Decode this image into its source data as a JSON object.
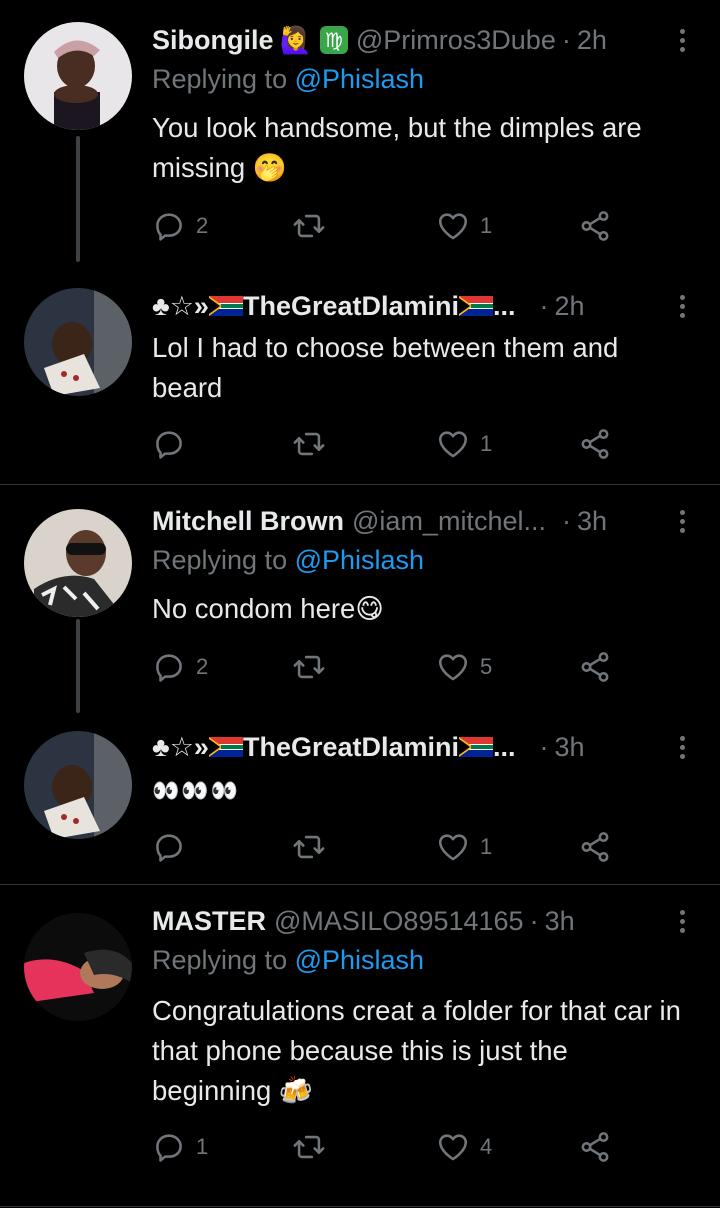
{
  "tweets": [
    {
      "name": "Sibongile",
      "name_emoji": "🙋‍♀️",
      "badge": "♍",
      "handle": "@Primros3Dube",
      "sep": "·",
      "time": "2h",
      "replying_prefix": "Replying to",
      "replying_to": "@Phislash",
      "text": "You look handsome, but the dimples are missing 🤭",
      "replies": "2",
      "retweets": "",
      "likes": "1"
    },
    {
      "name_prefix": "♣☆»",
      "name": "TheGreatDlamini",
      "name_suffix": "...",
      "sep": "·",
      "time": "2h",
      "text": "Lol I had to choose between them and beard",
      "replies": "",
      "retweets": "",
      "likes": "1"
    },
    {
      "name": "Mitchell Brown",
      "handle": "@iam_mitchel...",
      "sep": "·",
      "time": "3h",
      "replying_prefix": "Replying to",
      "replying_to": "@Phislash",
      "text": "No condom here😋",
      "replies": "2",
      "retweets": "",
      "likes": "5"
    },
    {
      "name_prefix": "♣☆»",
      "name": "TheGreatDlamini",
      "name_suffix": "...",
      "sep": "·",
      "time": "3h",
      "text": "👀👀👀",
      "replies": "",
      "retweets": "",
      "likes": "1"
    },
    {
      "name": "MASTER",
      "handle": "@MASILO89514165",
      "sep": "·",
      "time": "3h",
      "replying_prefix": "Replying to",
      "replying_to": "@Phislash",
      "text": "Congratulations creat a folder for that car in that phone because this is just the beginning 🍻",
      "replies": "1",
      "retweets": "",
      "likes": "4"
    }
  ],
  "colors": {
    "background": "#000000",
    "text": "#e7e9ea",
    "muted": "#71767b",
    "link": "#1d9bf0",
    "thread_line": "#3e4144"
  },
  "icons": [
    "reply-icon",
    "retweet-icon",
    "like-icon",
    "share-icon",
    "more-icon"
  ]
}
